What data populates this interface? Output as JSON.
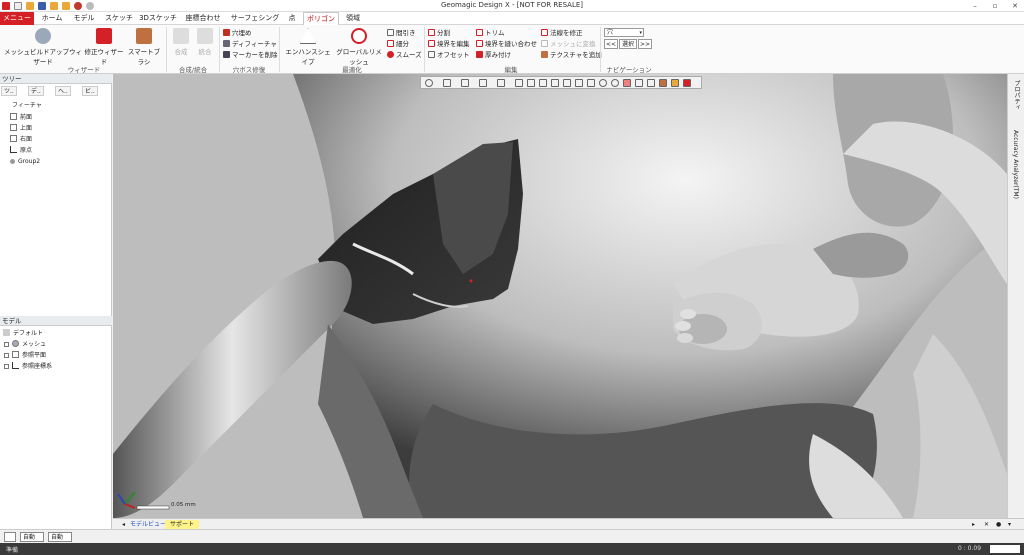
{
  "app": {
    "title": "Geomagic Design X - [NOT FOR RESALE]"
  },
  "window_controls": {
    "minimize": "–",
    "maximize": "▫",
    "close": "✕"
  },
  "tabs": [
    {
      "label": "メニュー"
    },
    {
      "label": "ホーム"
    },
    {
      "label": "モデル"
    },
    {
      "label": "スケッチ"
    },
    {
      "label": "3Dスケッチ"
    },
    {
      "label": "座標合わせ"
    },
    {
      "label": "サーフェシング"
    },
    {
      "label": "点"
    },
    {
      "label": "ポリゴン"
    },
    {
      "label": "領域"
    }
  ],
  "active_tab": "ポリゴン",
  "ribbon": {
    "wizard": {
      "label": "ウィザード",
      "buttons": [
        "メッシュビルドアップウィザード",
        "修正ウィザード",
        "スマートブラシ"
      ]
    },
    "merge": {
      "label": "合成/統合",
      "buttons": [
        "合成",
        "統合"
      ]
    },
    "hole": {
      "label": "穴ボス修復",
      "buttons": [
        "穴埋め",
        "ディフィーチャ",
        "マーカーを削除"
      ]
    },
    "optimize": {
      "label": "最適化",
      "buttons": [
        "エンハンスシェイプ",
        "グローバルリメッシュ"
      ],
      "small": [
        "間引き",
        "細分",
        "スムーズ"
      ]
    },
    "edit": {
      "label": "編集",
      "col1": [
        "分割",
        "境界を編集",
        "オフセット"
      ],
      "col2": [
        "トリム",
        "境界を縫い合わせ",
        "厚み付け"
      ],
      "col3": [
        "法線を修正",
        "メッシュに変換",
        "テクスチャを追加"
      ]
    },
    "nav": {
      "label": "ナビゲーション",
      "select_value": "穴",
      "prev": "<<",
      "select_btn": "選択",
      "next": ">>"
    }
  },
  "tree_panel": {
    "title": "ツリー",
    "tabs": [
      "ツ..",
      "デ..",
      "ヘ..",
      "ビ.."
    ],
    "feature_label": "フィーチャ",
    "features": [
      "前面",
      "上面",
      "右面",
      "原点",
      "Group2"
    ]
  },
  "model_panel": {
    "title": "モデル",
    "root": "デフォルト",
    "items": [
      "メッシュ",
      "参照平面",
      "参照座標系"
    ]
  },
  "right_sidebar": {
    "items": [
      "プロパティ",
      "Accuracy Analyzer(TM)"
    ]
  },
  "viewport": {
    "scale_label": "0.05 mm"
  },
  "bottom_tabs": [
    "モデルビュー",
    "サポート"
  ],
  "status": {
    "mode_label": "自動",
    "mode2_label": "自動",
    "ready": "準備",
    "coords": "0 : 0.09"
  },
  "colors": {
    "accent": "#d42027",
    "viewport_bg": "#bdbdbd",
    "status_bg": "#3a3a3a"
  }
}
